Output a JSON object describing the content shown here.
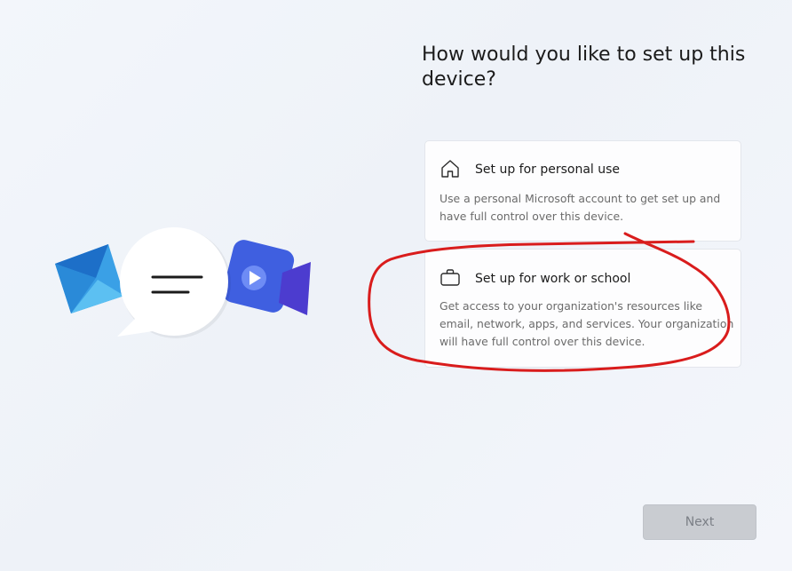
{
  "page": {
    "title": "How would you like to set up this device?"
  },
  "options": [
    {
      "title": "Set up for personal use",
      "description": "Use a personal Microsoft account to get set up and have full control over this device.",
      "icon": "home-icon"
    },
    {
      "title": "Set up for work or school",
      "description": "Get access to your organization's resources like email, network, apps, and services. Your organization will have full control over this device.",
      "icon": "briefcase-icon"
    }
  ],
  "footer": {
    "next_label": "Next"
  },
  "illustration": {
    "icons": [
      "mail-icon",
      "chat-bubble-icon",
      "video-camera-icon"
    ]
  },
  "colors": {
    "annotation": "#d91c1c",
    "accent_blue": "#1f7ae0",
    "video_purple": "#5a4bd8",
    "button_disabled": "#c9ccd1"
  }
}
